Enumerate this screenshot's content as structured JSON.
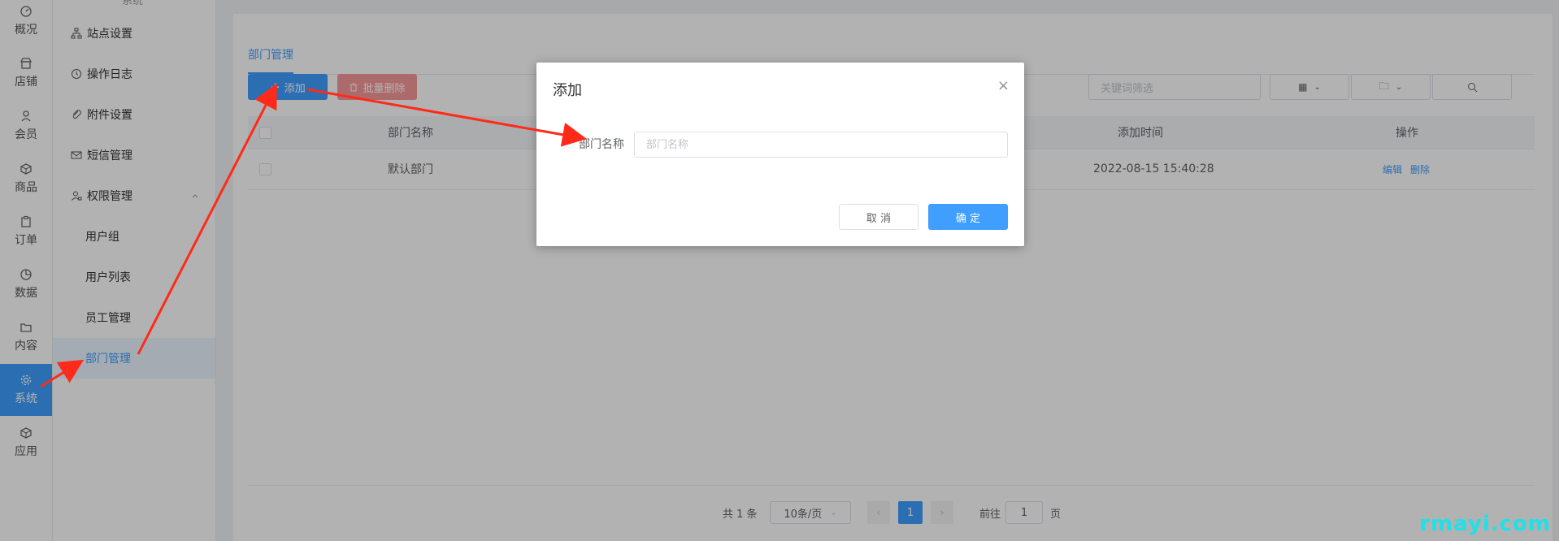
{
  "leftbar": {
    "items": [
      {
        "label": "概况",
        "icon": "dashboard-icon"
      },
      {
        "label": "店铺",
        "icon": "shop-icon"
      },
      {
        "label": "会员",
        "icon": "user-icon"
      },
      {
        "label": "商品",
        "icon": "box-icon"
      },
      {
        "label": "订单",
        "icon": "clipboard-icon"
      },
      {
        "label": "数据",
        "icon": "pie-icon"
      },
      {
        "label": "内容",
        "icon": "folder-icon"
      },
      {
        "label": "系统",
        "icon": "gear-icon"
      },
      {
        "label": "应用",
        "icon": "cube-icon"
      }
    ],
    "active": "系统"
  },
  "subnav": {
    "top_label": "系统",
    "items": [
      {
        "label": "站点设置",
        "icon": "sitemap-icon"
      },
      {
        "label": "操作日志",
        "icon": "history-icon"
      },
      {
        "label": "附件设置",
        "icon": "paperclip-icon"
      },
      {
        "label": "短信管理",
        "icon": "mail-icon"
      },
      {
        "label": "权限管理",
        "icon": "user-lock-icon"
      }
    ],
    "children": [
      {
        "label": "用户组"
      },
      {
        "label": "用户列表"
      },
      {
        "label": "员工管理"
      },
      {
        "label": "部门管理"
      }
    ],
    "active": "部门管理"
  },
  "main": {
    "tab": "部门管理",
    "add_label": "添加",
    "batch_delete_label": "批量删除",
    "filter_placeholder": "关键词筛选",
    "table": {
      "headers": [
        "部门名称",
        "添加时间",
        "操作"
      ],
      "rows": [
        {
          "name": "默认部门",
          "time": "2022-08-15 15:40:28",
          "edit": "编辑",
          "delete": "删除"
        }
      ]
    },
    "pagination": {
      "total": "共 1 条",
      "page_size": "10条/页",
      "current": "1",
      "goto_prefix": "前往",
      "goto_value": "1",
      "goto_suffix": "页"
    }
  },
  "dialog": {
    "title": "添加",
    "close": "×",
    "field_label": "部门名称",
    "field_placeholder": "部门名称",
    "cancel_label": "取 消",
    "ok_label": "确 定"
  },
  "watermark": "rmayi.com",
  "colors": {
    "primary": "#409eff",
    "danger_light": "#f89898",
    "annotation": "#ff2a1a"
  }
}
